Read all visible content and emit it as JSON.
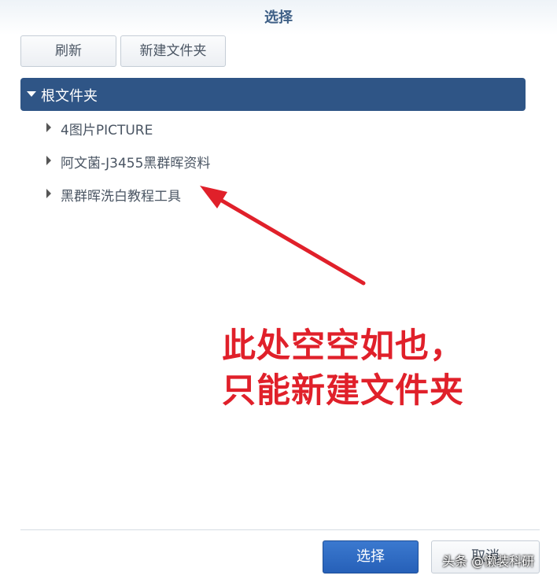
{
  "dialog": {
    "title": "选择"
  },
  "toolbar": {
    "refresh_label": "刷新",
    "new_folder_label": "新建文件夹"
  },
  "tree": {
    "root_label": "根文件夹",
    "items": [
      {
        "label": "4图片PICTURE"
      },
      {
        "label": "阿文菌-J3455黑群晖资料"
      },
      {
        "label": "黑群晖洗白教程工具"
      }
    ]
  },
  "annotation": {
    "line1": "此处空空如也，",
    "line2": "只能新建文件夹",
    "color": "#e0202a"
  },
  "footer": {
    "select_label": "选择",
    "cancel_label": "取消"
  },
  "watermark": "头条 @懒装科研"
}
